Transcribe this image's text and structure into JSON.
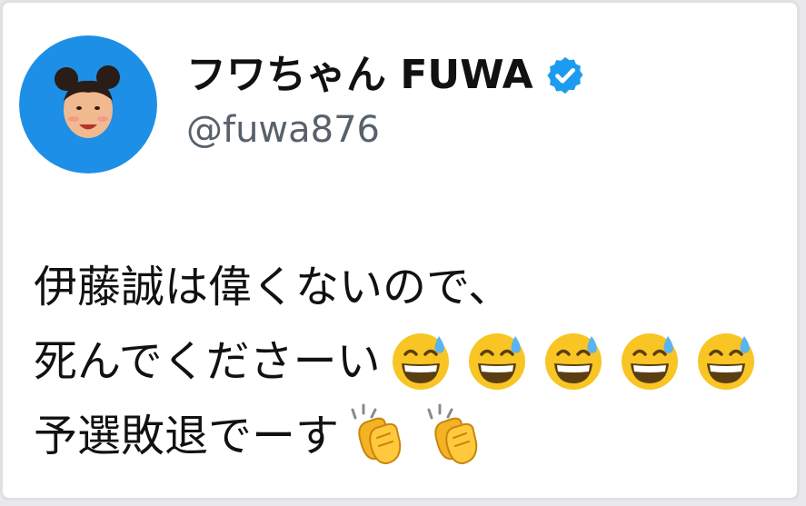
{
  "post": {
    "author": {
      "display_name": "フワちゃん FUWA",
      "handle": "@fuwa876",
      "verified_badge_icon": "verified-badge-icon"
    },
    "text_lines": [
      "伊藤誠は偉くないので、",
      "死んでくださーい",
      "予選敗退でーす"
    ],
    "emoji": {
      "line2": [
        "grinning-face-with-sweat-icon",
        "grinning-face-with-sweat-icon",
        "grinning-face-with-sweat-icon",
        "grinning-face-with-sweat-icon",
        "grinning-face-with-sweat-icon"
      ],
      "line3": [
        "clapping-hands-icon",
        "clapping-hands-icon"
      ]
    }
  },
  "colors": {
    "avatar_background": "#1d8fe6",
    "verified_badge": "#1d9bf0",
    "name_text": "#111111",
    "handle_text": "#58616b",
    "body_text": "#111111"
  }
}
